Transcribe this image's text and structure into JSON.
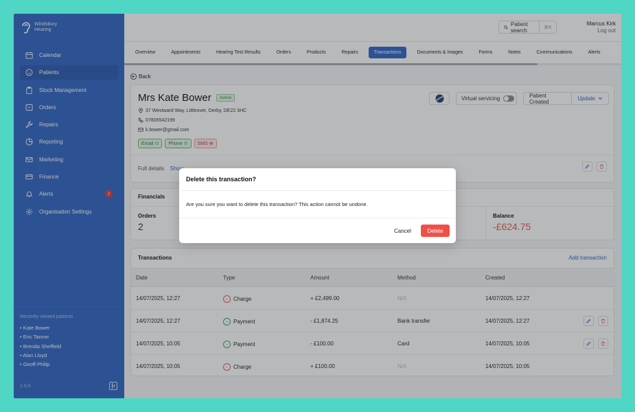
{
  "brand": {
    "line1": "Windsbury",
    "line2": "Hearing"
  },
  "sidebar": {
    "items": [
      {
        "label": "Calendar",
        "icon": "calendar-icon"
      },
      {
        "label": "Patients",
        "icon": "smile-icon",
        "active": true
      },
      {
        "label": "Stock Management",
        "icon": "clipboard-icon"
      },
      {
        "label": "Orders",
        "icon": "inbox-icon"
      },
      {
        "label": "Repairs",
        "icon": "wrench-icon"
      },
      {
        "label": "Reporting",
        "icon": "pie-chart-icon"
      },
      {
        "label": "Marketing",
        "icon": "mail-icon"
      },
      {
        "label": "Finance",
        "icon": "credit-card-icon"
      },
      {
        "label": "Alerts",
        "icon": "bell-icon",
        "badge": "2"
      },
      {
        "label": "Organisation Settings",
        "icon": "gear-icon"
      }
    ],
    "recent_title": "Recently viewed patients",
    "recent": [
      "• Kate Bower",
      "• Eric Tanner",
      "• Brenda Sheffield",
      "• Alan Lloyd",
      "• Geoff Philip"
    ],
    "version": "1.0.0"
  },
  "header": {
    "search_label": "Patient search",
    "search_shortcut": "⌘K",
    "user_name": "Marcus Kirk",
    "logout": "Log out"
  },
  "tabs": [
    "Overview",
    "Appointments",
    "Hearing Test Results",
    "Orders",
    "Products",
    "Repairs",
    "Transactions",
    "Documents & Images",
    "Forms",
    "Notes",
    "Communications",
    "Alerts"
  ],
  "active_tab": "Transactions",
  "back_label": "Back",
  "patient": {
    "name": "Mrs Kate Bower",
    "status": "Active",
    "address": "37 Westward Way, Littleover, Derby, DE22 3HC",
    "phone": "07806542199",
    "email": "k.bower@gmail.com",
    "chips": [
      {
        "label": "Email",
        "ok": true
      },
      {
        "label": "Phone",
        "ok": true
      },
      {
        "label": "SMS",
        "ok": false
      }
    ],
    "virtual_servicing": "Virtual servicing",
    "patient_created": "Patient Created",
    "update": "Update",
    "full_details": "Full details",
    "show": "Show"
  },
  "financials": {
    "title": "Financials",
    "orders_label": "Orders",
    "orders_value": "2",
    "balance_label": "Balance",
    "balance_value": "-£624.75"
  },
  "transactions": {
    "title": "Transactions",
    "add": "Add transaction",
    "columns": [
      "Date",
      "Type",
      "Amount",
      "Method",
      "Created"
    ],
    "rows": [
      {
        "date": "14/07/2025, 12:27",
        "type": "Charge",
        "amount": "+ £2,499.00",
        "method": "N/A",
        "created": "14/07/2025, 12:27",
        "actions": false
      },
      {
        "date": "14/07/2025, 12:27",
        "type": "Payment",
        "amount": "- £1,874.25",
        "method": "Bank transfer",
        "created": "14/07/2025, 12:27",
        "actions": true
      },
      {
        "date": "14/07/2025, 10:05",
        "type": "Payment",
        "amount": "- £100.00",
        "method": "Card",
        "created": "14/07/2025, 10:05",
        "actions": true
      },
      {
        "date": "14/07/2025, 10:05",
        "type": "Charge",
        "amount": "+ £100.00",
        "method": "N/A",
        "created": "14/07/2025, 10:05",
        "actions": false
      }
    ]
  },
  "modal": {
    "title": "Delete this transaction?",
    "body": "Are you sure you want to delete this transaction? This action cannot be undone.",
    "cancel": "Cancel",
    "delete": "Delete"
  },
  "colors": {
    "sidebar": "#2f66c4",
    "accent": "#2f66c4",
    "danger": "#f0504a",
    "page_bg": "#4fd6c4"
  }
}
